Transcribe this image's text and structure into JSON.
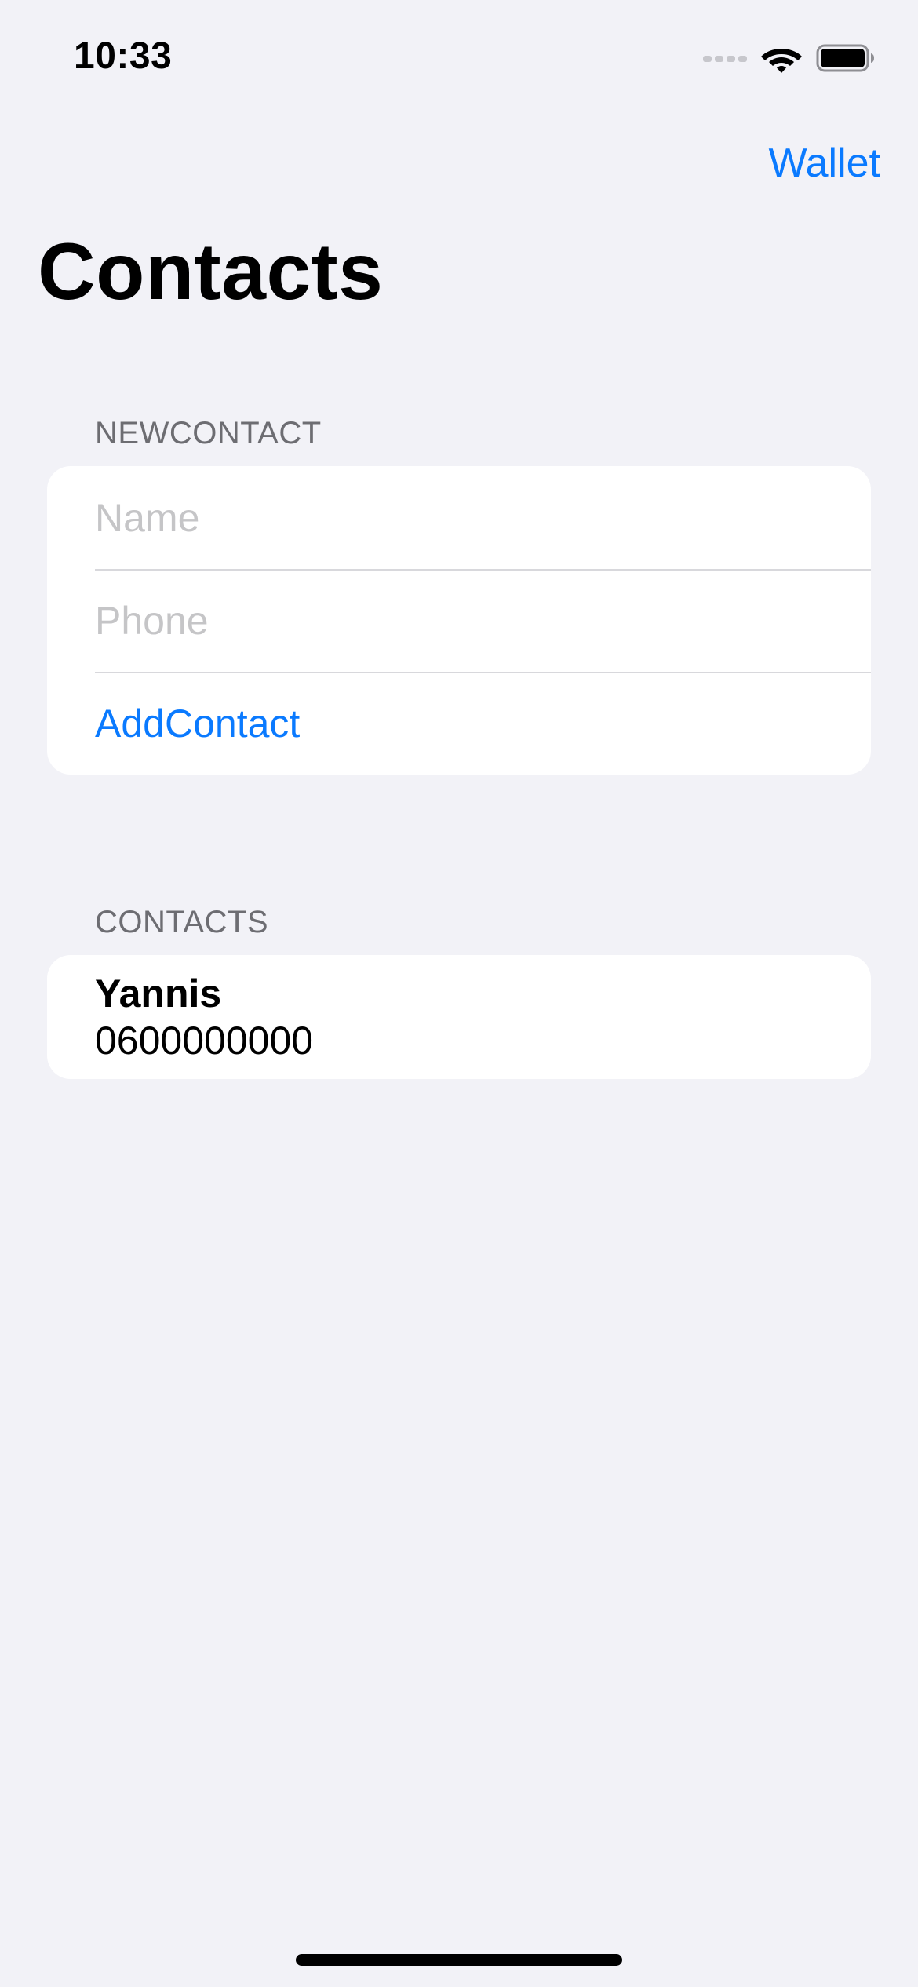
{
  "status_bar": {
    "time": "10:33"
  },
  "nav": {
    "right_button": "Wallet",
    "title": "Contacts"
  },
  "new_contact": {
    "header": "NEWCONTACT",
    "name_placeholder": "Name",
    "phone_placeholder": "Phone",
    "add_button": "AddContact"
  },
  "contacts": {
    "header": "CONTACTS",
    "items": [
      {
        "name": "Yannis",
        "phone": "0600000000"
      }
    ]
  },
  "colors": {
    "accent": "#0A7AFF",
    "background": "#F2F2F7",
    "section_header": "#6D6D72",
    "placeholder": "#C5C5C7"
  }
}
